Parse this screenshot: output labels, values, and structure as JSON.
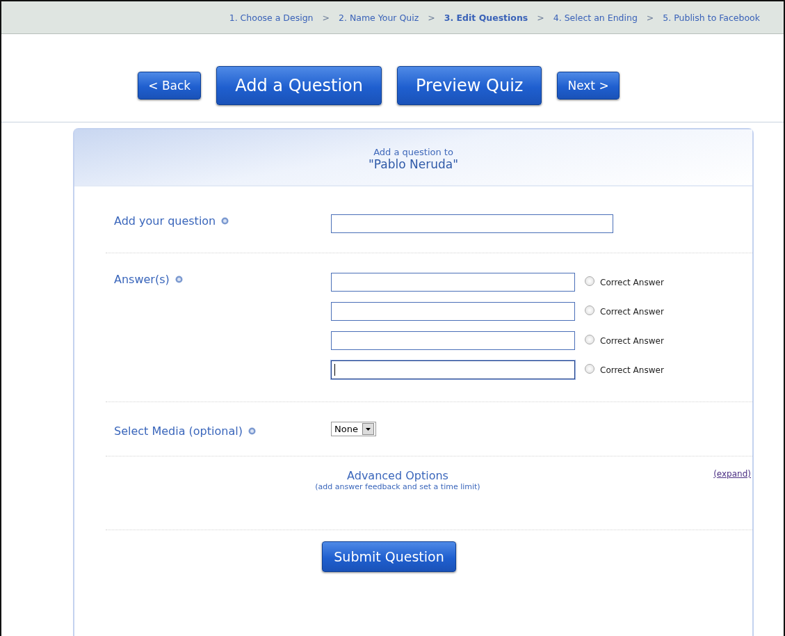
{
  "breadcrumb": [
    {
      "kind": "step",
      "label": "1. Choose a Design",
      "selected": false
    },
    {
      "kind": "separator",
      "label": ">"
    },
    {
      "kind": "step",
      "label": "2. Name Your Quiz",
      "selected": false
    },
    {
      "kind": "separator",
      "label": ">"
    },
    {
      "kind": "step",
      "label": "3. Edit Questions",
      "selected": true
    },
    {
      "kind": "separator",
      "label": ">"
    },
    {
      "kind": "step",
      "label": "4. Select an Ending",
      "selected": false
    },
    {
      "kind": "separator",
      "label": ">"
    },
    {
      "kind": "step",
      "label": "5. Publish to Facebook",
      "selected": false
    }
  ],
  "nav_buttons": [
    {
      "kind": "small",
      "label": "< Back"
    },
    {
      "kind": "large",
      "label": "Add a Question"
    },
    {
      "kind": "large",
      "label": "Preview Quiz"
    },
    {
      "kind": "small",
      "label": "Next >"
    }
  ],
  "card": {
    "heading": "Add a question to",
    "quiz_title": "\"Pablo Neruda\""
  },
  "question": {
    "label": "Add your question"
  },
  "answers": {
    "label": "Answer(s)",
    "items": [
      {
        "correct_label": "Correct Answer",
        "selected": false,
        "focused": false
      },
      {
        "correct_label": "Correct Answer",
        "selected": false,
        "focused": false
      },
      {
        "correct_label": "Correct Answer",
        "selected": false,
        "focused": false
      },
      {
        "correct_label": "Correct Answer",
        "selected": false,
        "focused": true
      }
    ]
  },
  "media": {
    "label": "Select Media (optional)",
    "value": "None"
  },
  "advanced": {
    "title": "Advanced Options",
    "subtitle": "(add answer feedback and set a time limit)",
    "link": "(expand)"
  },
  "submit": {
    "label": "Submit Question"
  }
}
